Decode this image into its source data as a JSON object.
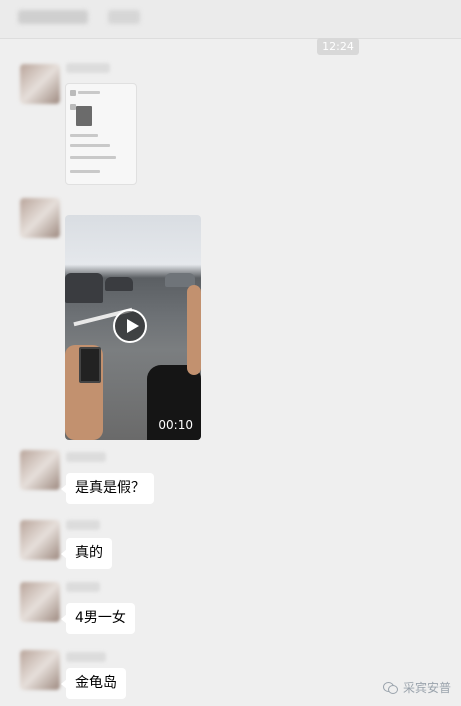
{
  "chat": {
    "timestamp": "12:24"
  },
  "messages": [
    {
      "type": "image",
      "icon": "chat-screenshot"
    },
    {
      "type": "video",
      "duration": "00:10",
      "icon": "play-icon"
    },
    {
      "type": "text",
      "text": "是真是假？"
    },
    {
      "type": "text",
      "text": "真的"
    },
    {
      "type": "text",
      "text": "4男一女"
    },
    {
      "type": "text",
      "text": "金龟岛"
    }
  ],
  "watermark": {
    "text": "采宾安普",
    "icon": "wechat-logo-icon"
  },
  "colors": {
    "background": "#efefef",
    "bubble": "#ffffff",
    "timestamp_bg": "#d8d8d8",
    "watermark": "#9aa3ac"
  }
}
